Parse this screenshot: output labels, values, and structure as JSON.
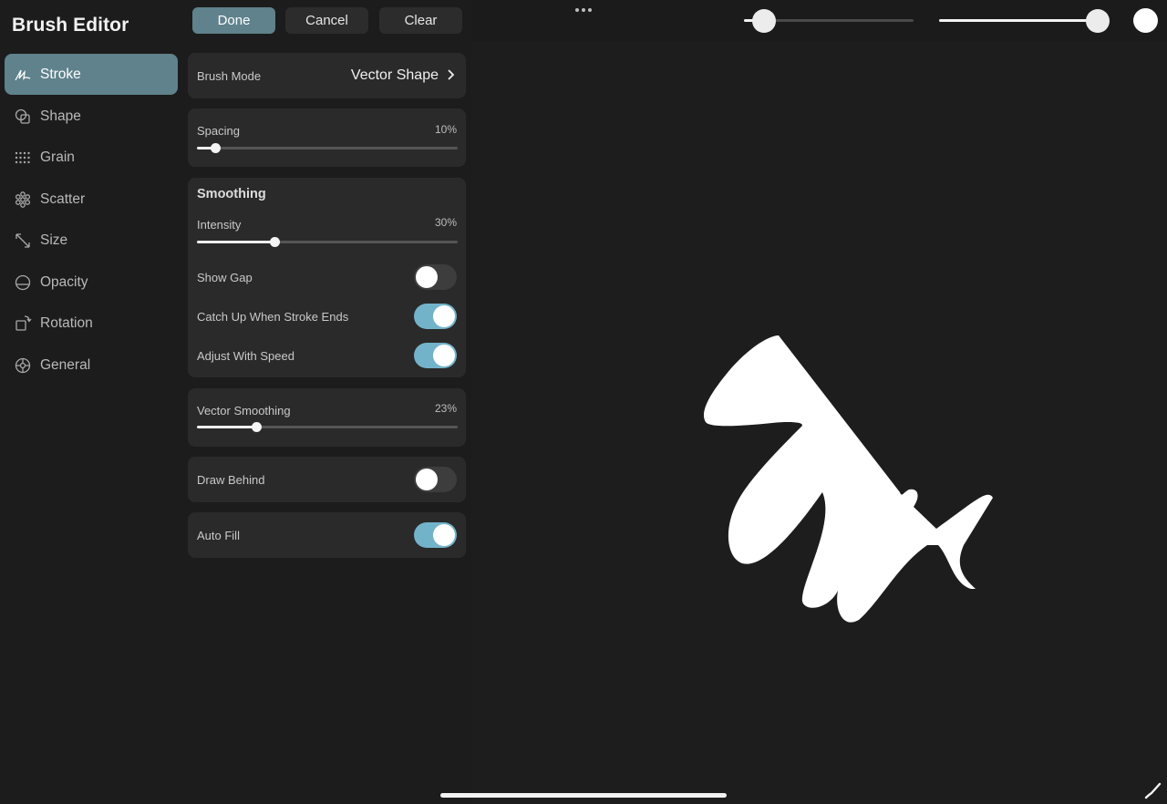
{
  "sidebar": {
    "title": "Brush Editor",
    "items": [
      {
        "label": "Stroke",
        "icon": "stroke-path-icon",
        "active": true
      },
      {
        "label": "Shape",
        "icon": "shape-icon",
        "active": false
      },
      {
        "label": "Grain",
        "icon": "grain-grid-icon",
        "active": false
      },
      {
        "label": "Scatter",
        "icon": "scatter-icon",
        "active": false
      },
      {
        "label": "Size",
        "icon": "resize-arrows-icon",
        "active": false
      },
      {
        "label": "Opacity",
        "icon": "opacity-icon",
        "active": false
      },
      {
        "label": "Rotation",
        "icon": "rotation-icon",
        "active": false
      },
      {
        "label": "General",
        "icon": "gear-icon",
        "active": false
      }
    ]
  },
  "toolbar": {
    "done_label": "Done",
    "cancel_label": "Cancel",
    "clear_label": "Clear"
  },
  "panel": {
    "brush_mode": {
      "label": "Brush Mode",
      "value": "Vector Shape"
    },
    "spacing": {
      "label": "Spacing",
      "value_text": "10%",
      "value": 0.07
    },
    "smoothing": {
      "title": "Smoothing",
      "intensity": {
        "label": "Intensity",
        "value_text": "30%",
        "value": 0.3
      },
      "show_gap": {
        "label": "Show Gap",
        "on": false
      },
      "catch_up": {
        "label": "Catch Up When Stroke Ends",
        "on": true
      },
      "adjust_speed": {
        "label": "Adjust With Speed",
        "on": true
      }
    },
    "vector_smoothing": {
      "label": "Vector Smoothing",
      "value_text": "23%",
      "value": 0.23
    },
    "draw_behind": {
      "label": "Draw Behind",
      "on": false
    },
    "auto_fill": {
      "label": "Auto Fill",
      "on": true
    }
  },
  "canvas": {
    "brush_size": 0.12,
    "brush_opacity": 0.99,
    "current_color": "#ffffff",
    "accent_color": "#5f828c",
    "toggle_on_color": "#73b3c9"
  }
}
